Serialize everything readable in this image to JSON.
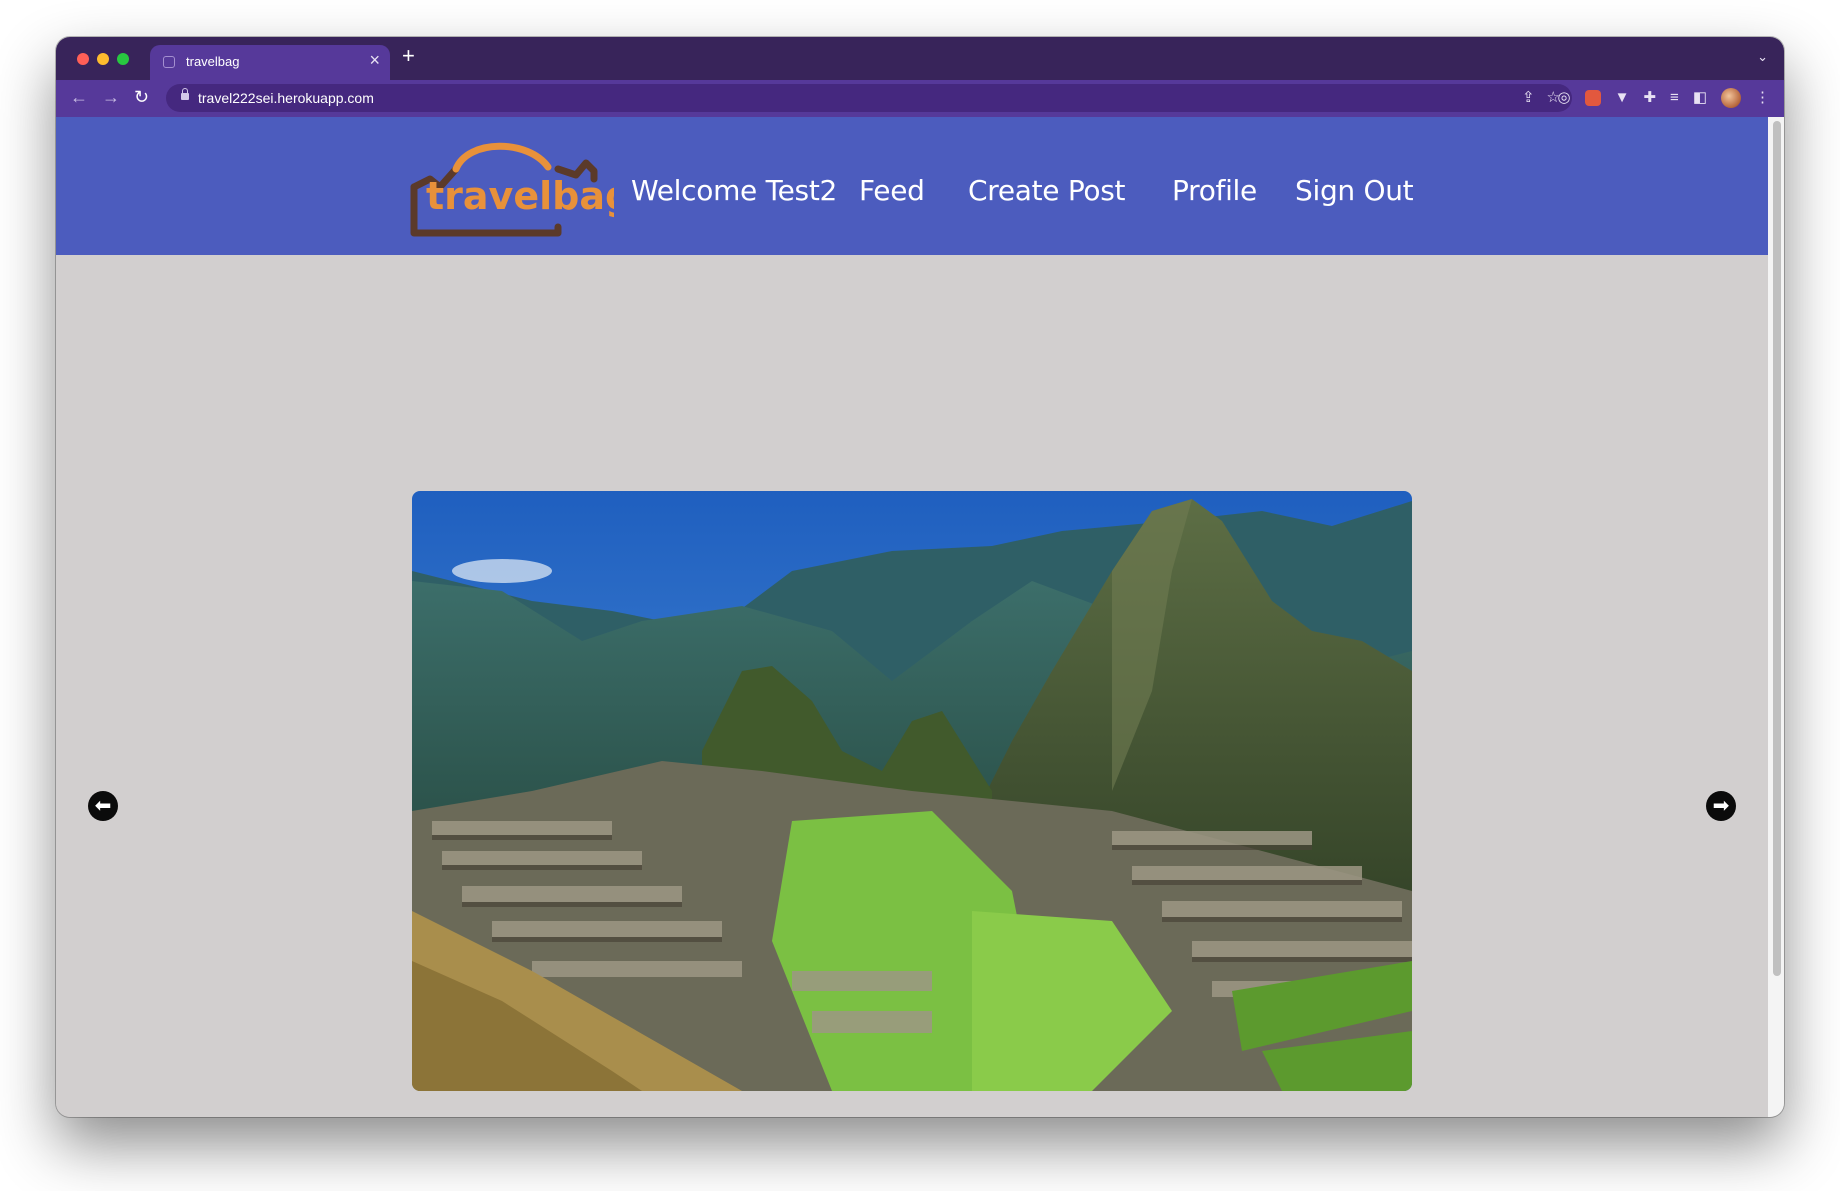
{
  "browser": {
    "tab_title": "travelbag",
    "tab_close": "×",
    "new_tab": "+",
    "tab_menu": "⌄",
    "url": "travel222sei.herokuapp.com",
    "nav_icons": {
      "back": "←",
      "forward": "→",
      "reload": "↻"
    },
    "omnibox_icons": [
      "share-icon",
      "bookmark-star-icon"
    ],
    "extension_icons": [
      "extension-target-icon",
      "extension-fox-icon",
      "extension-v-icon",
      "puzzle-extensions-icon",
      "reading-list-icon",
      "side-panel-icon",
      "profile-avatar",
      "menu-kebab-icon"
    ]
  },
  "header": {
    "logo_text": "travelbag",
    "welcome": "Welcome Test2",
    "nav": {
      "feed": "Feed",
      "create_post": "Create Post",
      "profile": "Profile",
      "sign_out": "Sign Out"
    }
  },
  "carousel": {
    "prev_icon": "arrow-left-circle-icon",
    "next_icon": "arrow-right-circle-icon"
  },
  "colors": {
    "tabstrip": "#38245a",
    "toolbar": "#56399a",
    "header": "#4c5cbe",
    "page_background": "#d2cfcf",
    "logo_orange": "#e8913a",
    "logo_brown": "#5b3a2a"
  }
}
